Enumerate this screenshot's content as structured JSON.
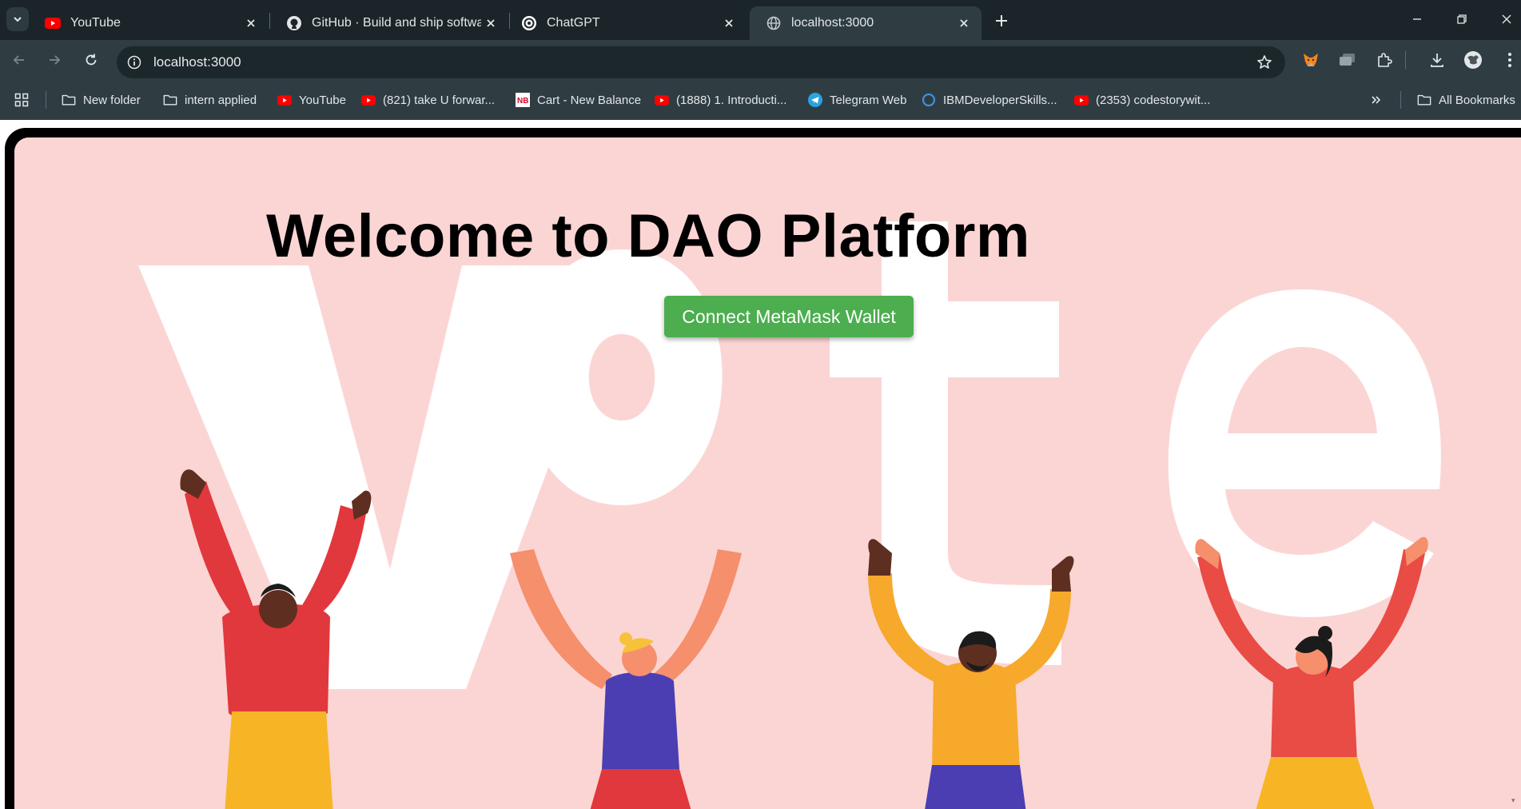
{
  "tabs": [
    {
      "title": "YouTube",
      "icon": "youtube-icon",
      "active": false
    },
    {
      "title": "GitHub · Build and ship software",
      "icon": "github-icon",
      "active": false
    },
    {
      "title": "ChatGPT",
      "icon": "chatgpt-icon",
      "active": false
    },
    {
      "title": "localhost:3000",
      "icon": "globe-icon",
      "active": true
    }
  ],
  "address_bar": {
    "url": "localhost:3000"
  },
  "bookmarks": [
    {
      "label": "New folder",
      "icon": "folder-icon"
    },
    {
      "label": "intern applied",
      "icon": "folder-icon"
    },
    {
      "label": "YouTube",
      "icon": "youtube-icon"
    },
    {
      "label": "(821) take U forwar...",
      "icon": "youtube-icon"
    },
    {
      "label": "Cart - New Balance",
      "icon": "new-balance-icon"
    },
    {
      "label": "(1888) 1. Introducti...",
      "icon": "youtube-icon"
    },
    {
      "label": "Telegram Web",
      "icon": "telegram-icon"
    },
    {
      "label": "IBMDeveloperSkills...",
      "icon": "ring-icon"
    },
    {
      "label": "(2353) codestorywit...",
      "icon": "youtube-icon"
    }
  ],
  "all_bookmarks_label": "All Bookmarks",
  "page": {
    "title": "Welcome to DAO Platform",
    "connect_button": "Connect MetaMask Wallet",
    "hero_word": "Vote"
  },
  "colors": {
    "page_background": "#fbd5d4",
    "button": "#4cae4f",
    "browser_chrome": "#2f3d43"
  }
}
